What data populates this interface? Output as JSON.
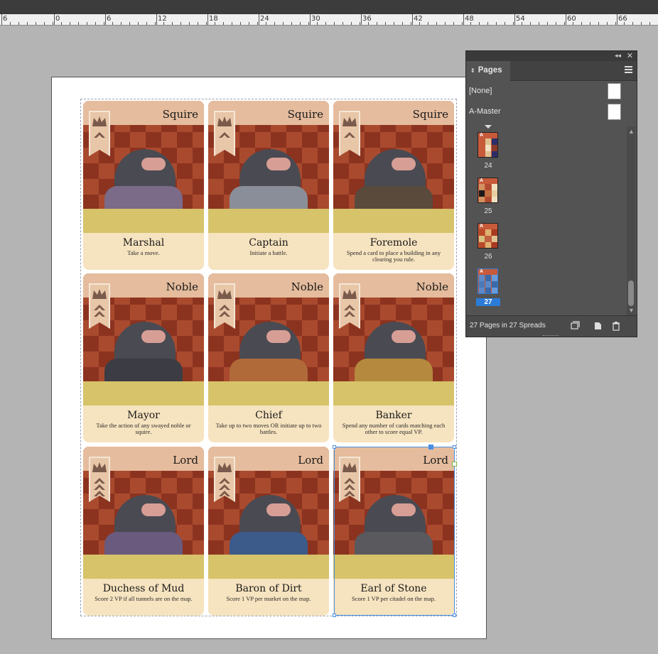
{
  "ruler": {
    "labels": [
      "6",
      "0",
      "6",
      "12",
      "18",
      "24",
      "30",
      "36",
      "42",
      "48",
      "54",
      "60",
      "66"
    ]
  },
  "cards": [
    {
      "rank": "Squire",
      "name": "Marshal",
      "desc": "Take a move.",
      "coat": "#7b6a88"
    },
    {
      "rank": "Squire",
      "name": "Captain",
      "desc": "Initiate a battle.",
      "coat": "#8a8e98"
    },
    {
      "rank": "Squire",
      "name": "Foremole",
      "desc": "Spend a card to place a building in any clearing you rule.",
      "coat": "#5a4a3c"
    },
    {
      "rank": "Noble",
      "name": "Mayor",
      "desc": "Take the action of any swayed noble or squire.",
      "coat": "#3c3c44"
    },
    {
      "rank": "Noble",
      "name": "Chief",
      "desc": "Take up to two moves OR initiate up to two battles.",
      "coat": "#b06a3a"
    },
    {
      "rank": "Noble",
      "name": "Banker",
      "desc": "Spend any number of cards matching each other to score equal VP.",
      "coat": "#b58a3e"
    },
    {
      "rank": "Lord",
      "name": "Duchess of Mud",
      "desc": "Score 2 VP if all tunnels are on the map.",
      "coat": "#6a5a7e"
    },
    {
      "rank": "Lord",
      "name": "Baron of Dirt",
      "desc": "Score 1 VP per market on the map.",
      "coat": "#3c5a8a"
    },
    {
      "rank": "Lord",
      "name": "Earl of Stone",
      "desc": "Score 1 VP per citadel on the map.",
      "coat": "#5a5a5e"
    }
  ],
  "panel": {
    "title": "Pages",
    "masters": [
      "[None]",
      "A-Master"
    ],
    "pages": [
      {
        "label": "24",
        "active": false
      },
      {
        "label": "25",
        "active": false
      },
      {
        "label": "26",
        "active": false
      },
      {
        "label": "27",
        "active": true
      }
    ],
    "thumb_letter": "A",
    "status": "27 Pages in 27 Spreads"
  }
}
